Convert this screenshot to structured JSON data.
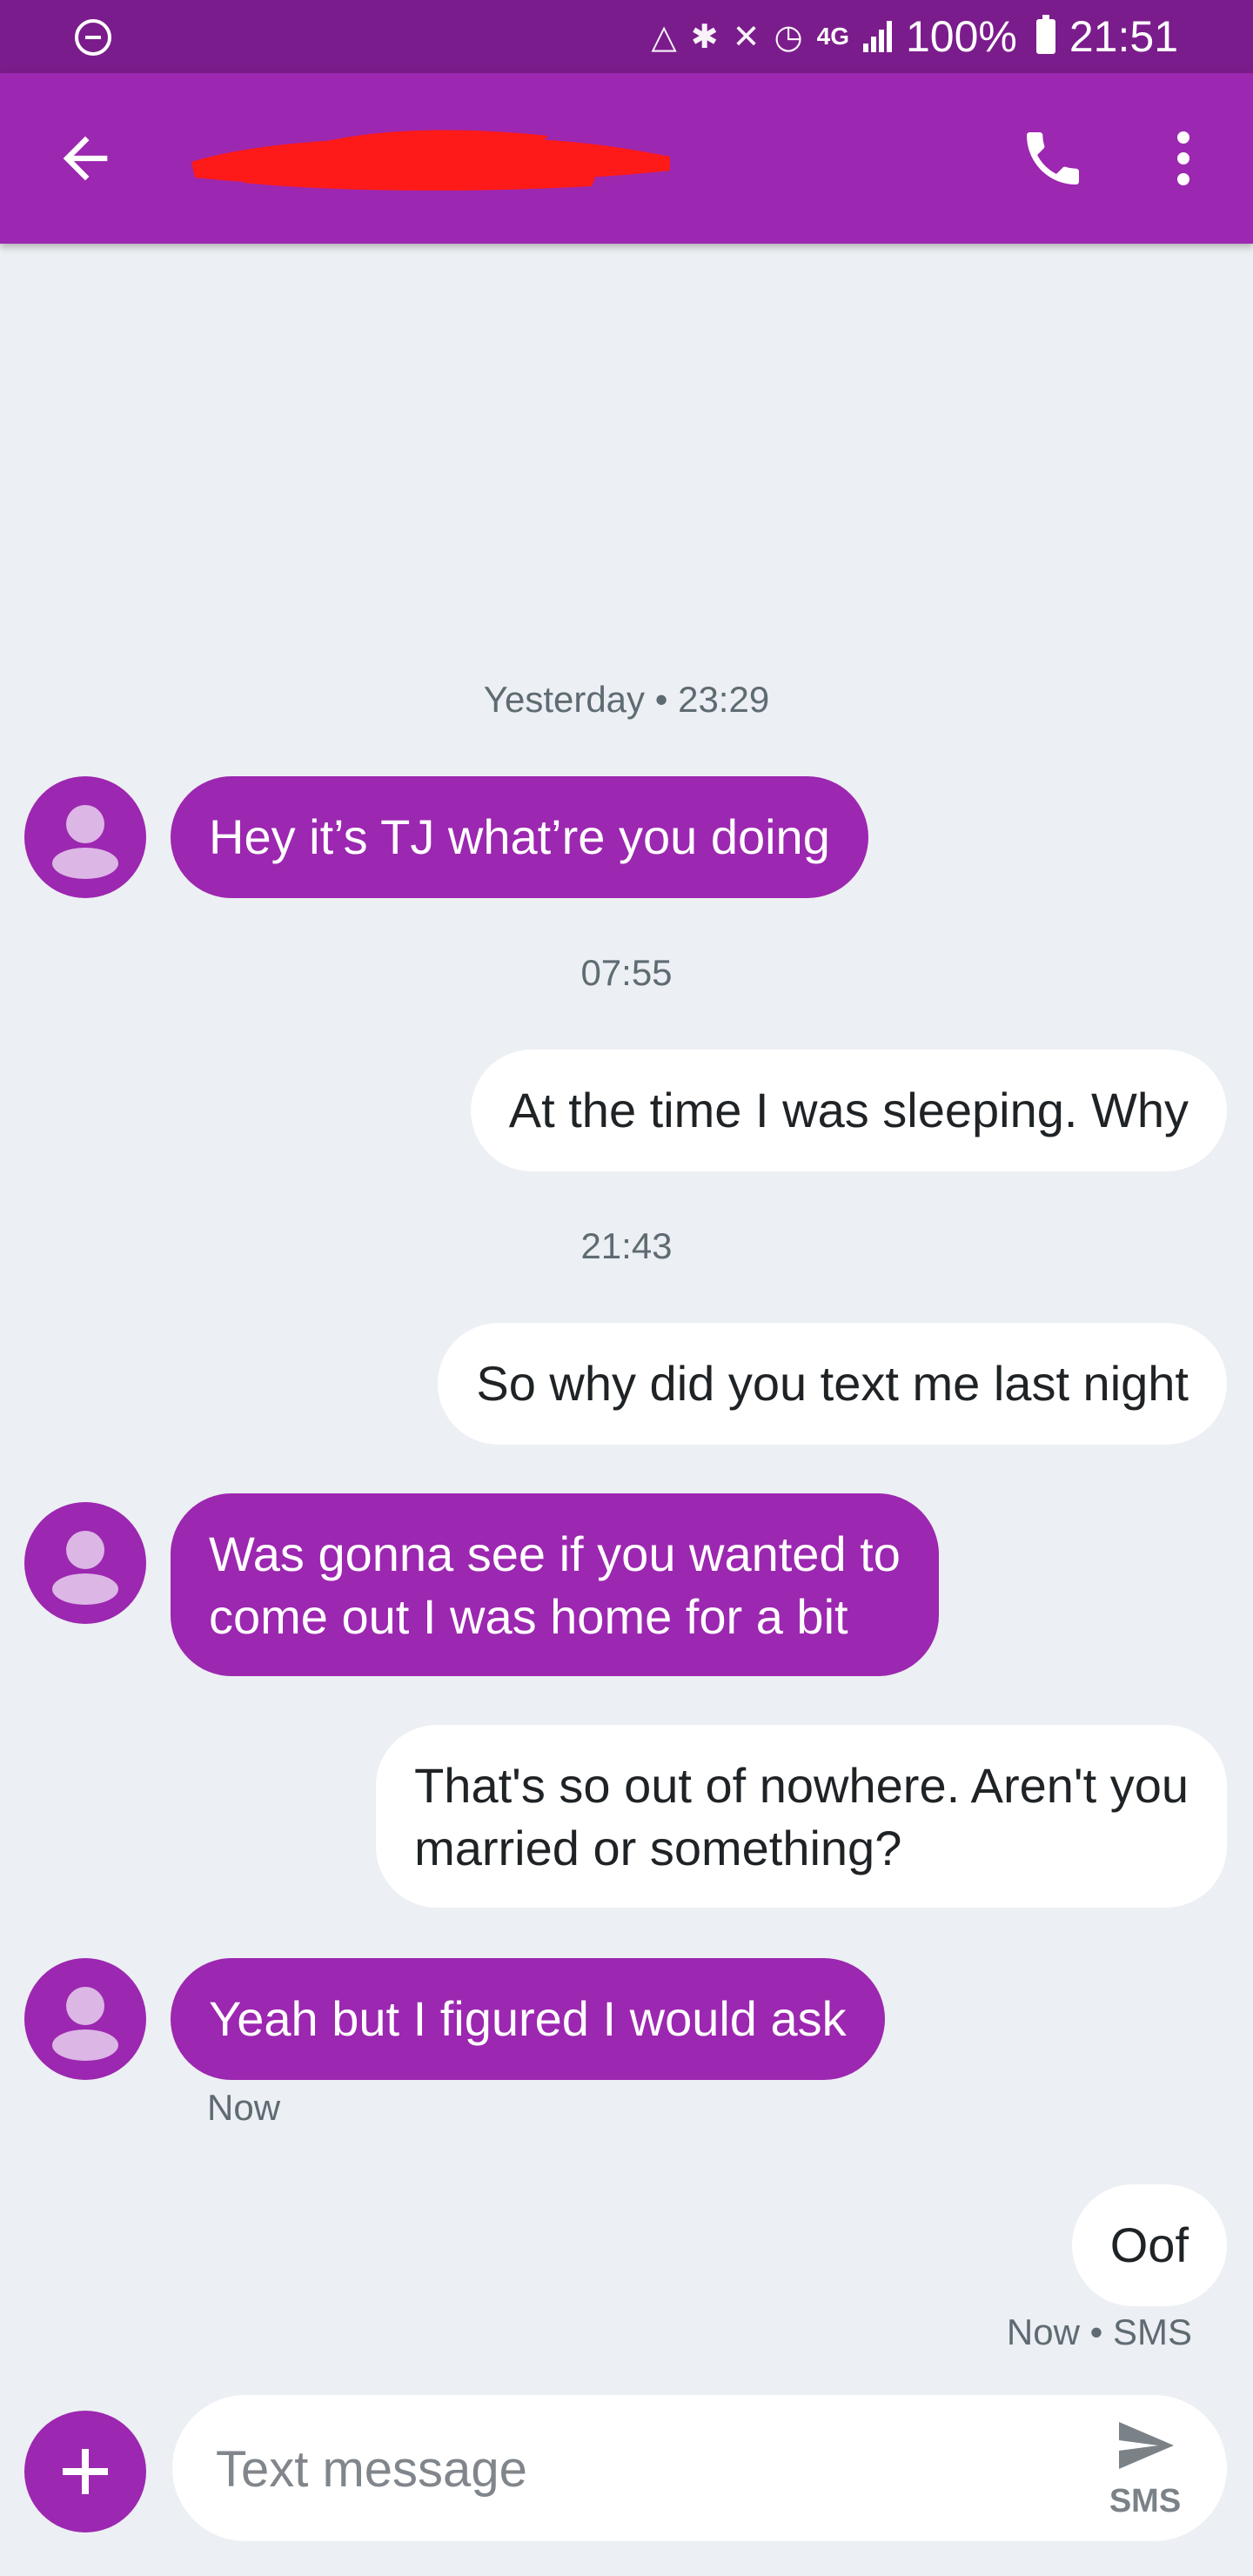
{
  "status_bar": {
    "time": "21:51",
    "battery": "100%",
    "network": "4G",
    "icons": [
      "dnd-icon",
      "data-saver-icon",
      "bluetooth-icon",
      "mute-icon",
      "alarm-icon",
      "signal-icon",
      "battery-icon"
    ]
  },
  "app_bar": {
    "contact_name": "",
    "icons": [
      "back-arrow-icon",
      "phone-icon",
      "more-vert-icon"
    ]
  },
  "messages": [
    {
      "type": "timestamp",
      "text": "Yesterday • 23:29"
    },
    {
      "type": "incoming",
      "text": "Hey it’s TJ what’re you doing"
    },
    {
      "type": "timestamp",
      "text": "07:55"
    },
    {
      "type": "outgoing",
      "text": "At the time I was sleeping. Why"
    },
    {
      "type": "timestamp",
      "text": "21:43"
    },
    {
      "type": "outgoing",
      "text": "So why did you text me last night"
    },
    {
      "type": "incoming",
      "lines": [
        "Was gonna see if you wanted to",
        "come out I was home for a bit"
      ]
    },
    {
      "type": "outgoing",
      "lines": [
        "That's so out of nowhere. Aren't you",
        "married or something?"
      ]
    },
    {
      "type": "incoming",
      "text": "Yeah but I figured I would ask",
      "meta": "Now"
    },
    {
      "type": "outgoing",
      "text": "Oof",
      "meta": "Now • SMS"
    }
  ],
  "compose": {
    "placeholder": "Text message",
    "send_label": "SMS"
  },
  "colors": {
    "status_bar": "#7b1c8c",
    "accent": "#9c27b0",
    "background": "#eceff3",
    "outgoing_bubble": "#ffffff",
    "redaction": "#ff0000"
  }
}
